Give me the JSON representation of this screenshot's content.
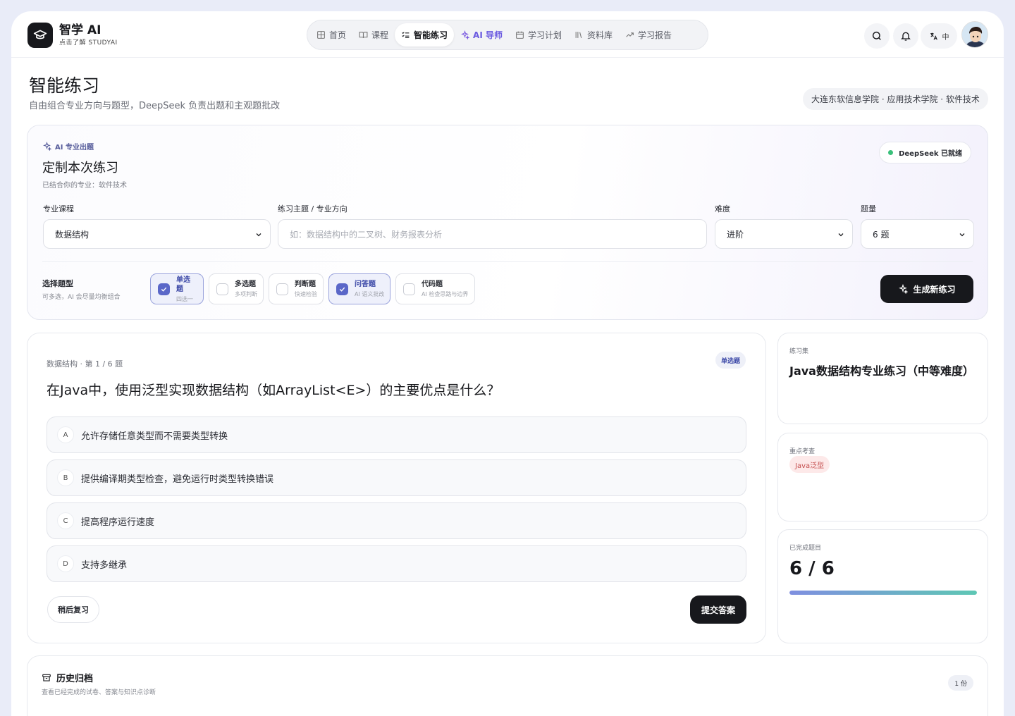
{
  "brand": {
    "name": "智学 AI",
    "tagline": "点击了解 STUDYAI"
  },
  "nav": {
    "items": [
      {
        "label": "首页"
      },
      {
        "label": "课程"
      },
      {
        "label": "智能练习"
      },
      {
        "label": "AI 导师"
      },
      {
        "label": "学习计划"
      },
      {
        "label": "资料库"
      },
      {
        "label": "学习报告"
      }
    ],
    "active": "智能练习"
  },
  "header": {
    "lang": "中"
  },
  "page": {
    "title": "智能练习",
    "subtitle": "自由组合专业方向与题型，DeepSeek 负责出题和主观题批改",
    "school": "大连东软信息学院 · 应用技术学院 · 软件技术"
  },
  "generator": {
    "tag": "AI 专业出题",
    "title": "定制本次练习",
    "subtitle": "已结合你的专业：软件技术",
    "status": "DeepSeek 已就绪",
    "course_label": "专业课程",
    "course_value": "数据结构",
    "topic_label": "练习主题 / 专业方向",
    "topic_placeholder": "如：数据结构中的二叉树、财务报表分析",
    "difficulty_label": "难度",
    "difficulty_value": "进阶",
    "count_label": "题量",
    "count_value": "6 题",
    "types_label": "选择题型",
    "types_hint": "可多选，AI 会尽量均衡组合",
    "types": [
      {
        "name": "单选题",
        "desc": "四选一",
        "checked": true
      },
      {
        "name": "多选题",
        "desc": "多项判断",
        "checked": false
      },
      {
        "name": "判断题",
        "desc": "快速检验",
        "checked": false
      },
      {
        "name": "问答题",
        "desc": "AI 语义批改",
        "checked": true
      },
      {
        "name": "代码题",
        "desc": "AI 检查思路与边界",
        "checked": false
      }
    ],
    "generate_label": "生成新练习"
  },
  "question": {
    "meta": "数据结构 · 第 1 / 6 题",
    "type": "单选题",
    "text": "在Java中，使用泛型实现数据结构（如ArrayList<E>）的主要优点是什么？",
    "options": [
      {
        "letter": "A",
        "text": "允许存储任意类型而不需要类型转换"
      },
      {
        "letter": "B",
        "text": "提供编译期类型检查，避免运行时类型转换错误"
      },
      {
        "letter": "C",
        "text": "提高程序运行速度"
      },
      {
        "letter": "D",
        "text": "支持多继承"
      }
    ],
    "later_label": "稍后复习",
    "submit_label": "提交答案"
  },
  "sidebar": {
    "set_label": "练习集",
    "set_name": "Java数据结构专业练习（中等难度）",
    "focus_label": "重点考查",
    "focus_tags": [
      "Java泛型"
    ],
    "done_label": "已完成题目",
    "done_value": "6 / 6",
    "done_fraction": 1.0
  },
  "history": {
    "title": "历史归档",
    "subtitle": "查看已经完成的试卷、答案与知识点诊断",
    "count": "1 份"
  }
}
